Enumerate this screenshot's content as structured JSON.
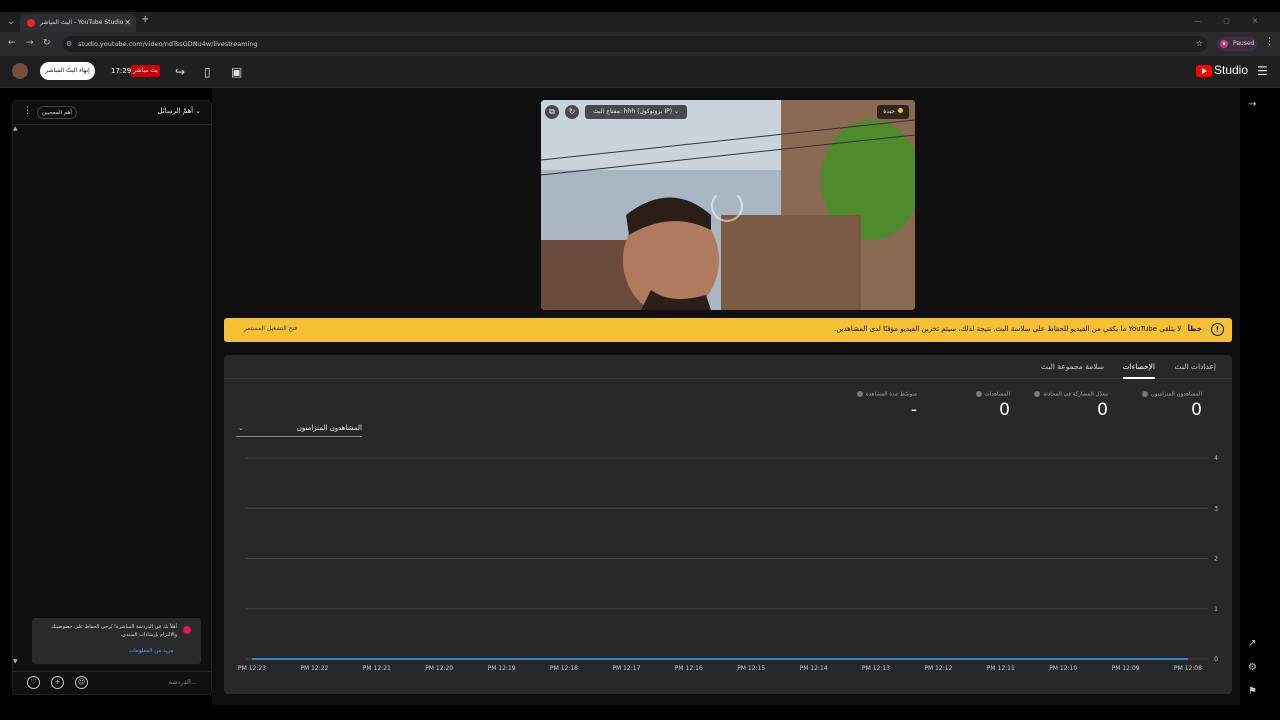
{
  "browser": {
    "tab_title": "البث المباشر - YouTube Studio",
    "url": "studio.youtube.com/video/ndTssGDNu4w/livestreaming",
    "profile_initial": "a",
    "profile_status": "Paused"
  },
  "header": {
    "brand": "Studio",
    "end_stream_label": "إنهاء البثّ المباشر",
    "timer": "17:29",
    "live_badge": "بث مباشر"
  },
  "chat": {
    "title": "أهمّ الرسائل",
    "top_fans_label": "أهم المعجبين",
    "notice_text": "أهلاً بك في الدردشة المباشرة! يُرجى الحفاظ على خصوصيتك والالتزام بإرشادات المنتدى.",
    "notice_link": "مزيد من المعلومات",
    "input_placeholder": "الدردشة..."
  },
  "video": {
    "stream_key_label": "مفتاح البث: hhh (بروتوكول IP)",
    "status_label": "جيدة"
  },
  "banner": {
    "error_word": "خطأ",
    "message": "لا يتلقى YouTube ما يكفي من الفيديو للحفاظ على سلاسة البث. نتيجة لذلك، سيتم تخزين الفيديو مؤقتًا لدى المشاهدين.",
    "manage_label": "فتح التشغيل المستمر"
  },
  "tabs": [
    {
      "label": "إعدادات البث",
      "active": false
    },
    {
      "label": "الإحصاءات",
      "active": true
    },
    {
      "label": "سلامة مجموعة البث",
      "active": false
    }
  ],
  "metrics": [
    {
      "label": "المشاهدون المتزامنون",
      "value": "0"
    },
    {
      "label": "معدّل المشاركة في المحادثة",
      "value": "0"
    },
    {
      "label": "المشاهدات",
      "value": "0"
    },
    {
      "label": "متوسّط مدة المشاهدة",
      "value": "-"
    }
  ],
  "chart_selector": "المشاهدون المتزامنون",
  "chart_data": {
    "type": "line",
    "x": [
      "12:23 PM",
      "12:22 PM",
      "12:21 PM",
      "12:20 PM",
      "12:19 PM",
      "12:18 PM",
      "12:17 PM",
      "12:16 PM",
      "12:15 PM",
      "12:14 PM",
      "12:13 PM",
      "12:12 PM",
      "12:11 PM",
      "12:10 PM",
      "12:09 PM",
      "12:08 PM"
    ],
    "x_tick_labels": [
      "PM 12:23",
      "PM 12:22",
      "PM 12:21",
      "PM 12:20",
      "PM 12:19",
      "PM 12:18",
      "PM 12:17",
      "PM 12:16",
      "PM 12:15",
      "PM 12:14",
      "PM 12:13",
      "PM 12:12",
      "PM 12:11",
      "PM 12:10",
      "PM 12:09",
      "PM 12:08"
    ],
    "series": [
      {
        "values": [
          0,
          0,
          0,
          0,
          0,
          0,
          0,
          0,
          0,
          0,
          0,
          0,
          0,
          0,
          0,
          0
        ]
      }
    ],
    "yticks": [
      0,
      1,
      2,
      3,
      4
    ],
    "ylim": [
      0,
      4
    ],
    "grid": true,
    "line_color": "#3ea6ff"
  },
  "colors": {
    "banner": "#f5c033",
    "live": "#cc0000",
    "brand_red": "#ff0000",
    "link": "#3ea6ff"
  }
}
